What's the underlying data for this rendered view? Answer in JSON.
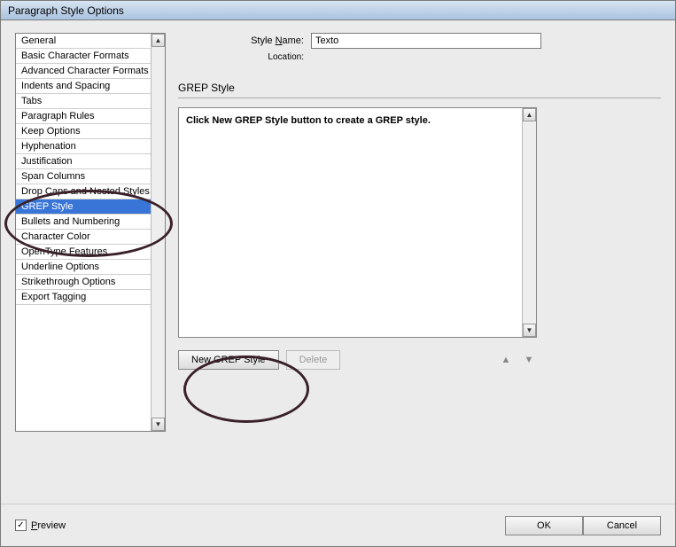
{
  "title": "Paragraph Style Options",
  "sidebar": {
    "items": [
      "General",
      "Basic Character Formats",
      "Advanced Character Formats",
      "Indents and Spacing",
      "Tabs",
      "Paragraph Rules",
      "Keep Options",
      "Hyphenation",
      "Justification",
      "Span Columns",
      "Drop Caps and Nested Styles",
      "GREP Style",
      "Bullets and Numbering",
      "Character Color",
      "OpenType Features",
      "Underline Options",
      "Strikethrough Options",
      "Export Tagging"
    ],
    "selected_index": 11
  },
  "form": {
    "style_name_label_pre": "Style ",
    "style_name_label_u": "N",
    "style_name_label_post": "ame:",
    "style_name_value": "Texto",
    "location_label": "Location:"
  },
  "panel": {
    "section_title": "GREP Style",
    "message": "Click New GREP Style button to create a GREP style.",
    "new_button": "New GREP Style",
    "delete_button": "Delete"
  },
  "footer": {
    "preview_check": true,
    "preview_label_u": "P",
    "preview_label_post": "review",
    "ok": "OK",
    "cancel": "Cancel"
  }
}
